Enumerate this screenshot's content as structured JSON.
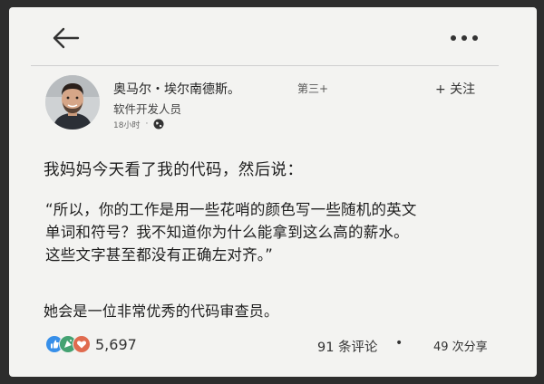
{
  "header": {
    "back_icon": "arrow-left-icon",
    "more_icon": "more-horizontal-icon"
  },
  "author": {
    "name": "奥马尔・埃尔南德斯。",
    "degree": "第三+",
    "follow_label": "+ 关注",
    "title": "软件开发人员",
    "time": "18小时",
    "visibility_icon": "globe-icon",
    "meta_separator": "·"
  },
  "post": {
    "intro": "我妈妈今天看了我的代码，然后说：",
    "quote_lines": [
      "“所以，你的工作是用一些花哨的颜色写一些随机的英文",
      "单词和符号？我不知道你为什么能拿到这么高的薪水。",
      "这些文字甚至都没有正确左对齐。”"
    ],
    "closing": "她会是一位非常优秀的代码审查员。"
  },
  "engagement": {
    "reaction_icons": [
      "like-icon",
      "celebrate-icon",
      "love-icon"
    ],
    "reaction_count": "5,697",
    "comments": "91 条评论",
    "separator": "•",
    "shares": "49 次分享"
  }
}
